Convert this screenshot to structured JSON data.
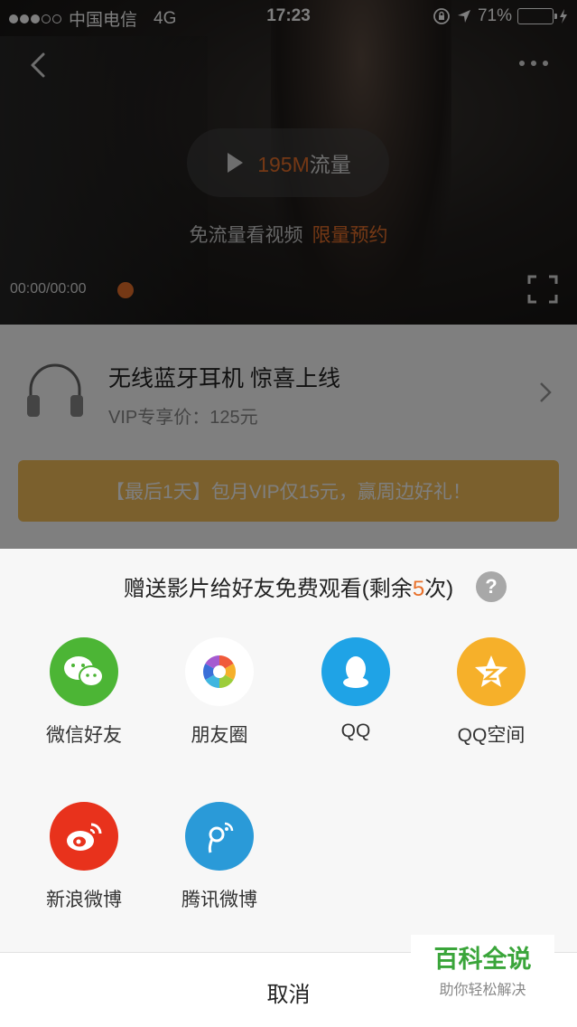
{
  "status_bar": {
    "carrier": "中国电信",
    "network": "4G",
    "time": "17:23",
    "battery_percent": "71%",
    "battery_level": 0.71
  },
  "player": {
    "traffic_size": "195M",
    "traffic_label": "流量",
    "free_text": "免流量看视频",
    "free_link": "限量预约",
    "timecode": "00:00/00:00"
  },
  "promo": {
    "title": "无线蓝牙耳机 惊喜上线",
    "price": "VIP专享价：125元"
  },
  "vip_banner": "【最后1天】包月VIP仅15元，赢周边好礼！",
  "share_sheet": {
    "title_prefix": "赠送影片给好友免费观看(剩余",
    "remaining": "5",
    "title_suffix": "次)",
    "help": "?",
    "items": [
      {
        "label": "微信好友",
        "color": "#4cb535"
      },
      {
        "label": "朋友圈",
        "color": "#ffffff"
      },
      {
        "label": "QQ",
        "color": "#1fa3e6"
      },
      {
        "label": "QQ空间",
        "color": "#f6b02a"
      },
      {
        "label": "新浪微博",
        "color": "#e8321c"
      },
      {
        "label": "腾讯微博",
        "color": "#2a9ad8"
      }
    ],
    "cancel": "取消"
  },
  "watermark": {
    "brand": "百科全说",
    "slogan": "助你轻松解决"
  },
  "colors": {
    "accent": "#e8702a",
    "vip_banner": "#f6c15a"
  }
}
